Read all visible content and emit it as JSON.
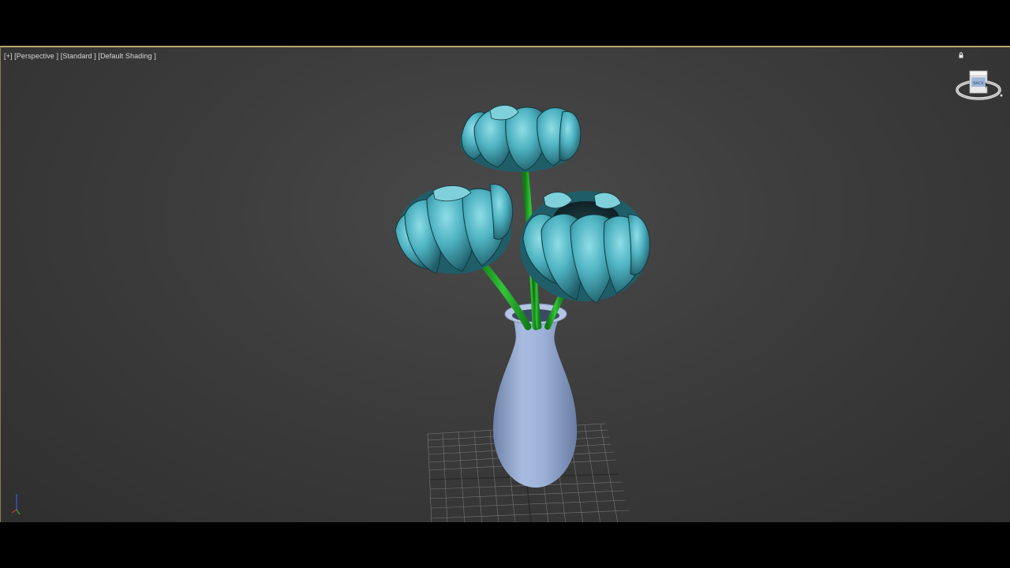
{
  "viewport": {
    "label_plus": "[+]",
    "label_view": "[Perspective ]",
    "label_preset": "[Standard ]",
    "label_shading": "[Default Shading ]"
  },
  "viewcube": {
    "face_label": "BACK"
  },
  "colors": {
    "petal": "#4fb3c2",
    "petal_dark": "#1f5e69",
    "stem": "#1fa324",
    "vase": "#97abd3",
    "grid": "#8c8c8c",
    "border_active": "#b9a76a"
  },
  "icons": {
    "viewcube": "viewcube-icon",
    "lock": "lock-icon",
    "axis": "axis-tripod-icon"
  }
}
